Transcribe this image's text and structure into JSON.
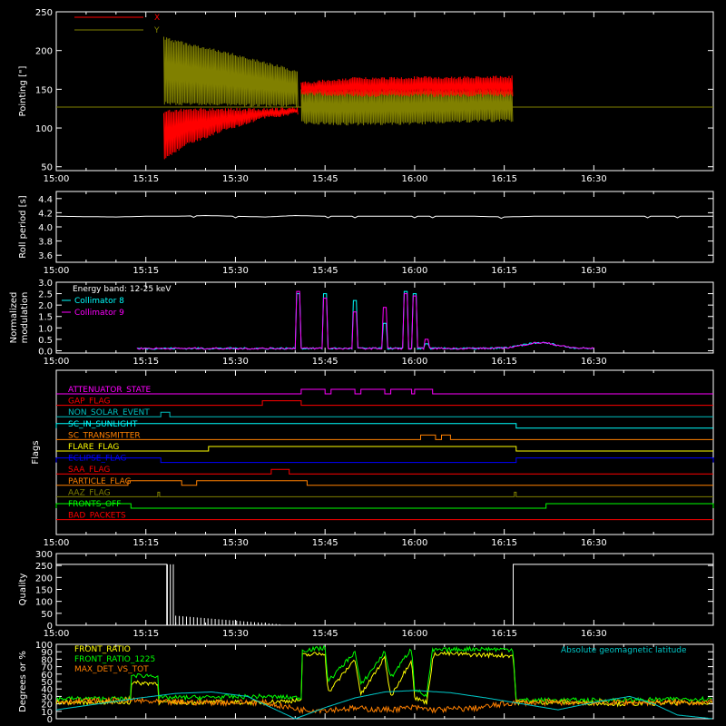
{
  "colors": {
    "background": "#000000",
    "axes": "#ffffff",
    "x_red": "#ff0000",
    "y_olive": "#808000",
    "collimator8": "#00ffff",
    "collimator9": "#ff00ff",
    "front_ratio": "#ffff00",
    "front_ratio_1225": "#00ff00",
    "max_det": "#ff8000",
    "latitude": "#00c8c8"
  },
  "time_axis": {
    "range_min": [
      0,
      110
    ],
    "tick_minutes": [
      0,
      15,
      30,
      45,
      60,
      75,
      90
    ],
    "tick_labels": [
      "15:00",
      "15:15",
      "15:30",
      "15:45",
      "16:00",
      "16:15",
      "16:30"
    ]
  },
  "chart_data": [
    {
      "type": "line",
      "ylabel": "Pointing [\"]",
      "ylim": [
        45,
        250
      ],
      "yticks": [
        50,
        100,
        150,
        200,
        250
      ],
      "legend_position": "top-left",
      "series": [
        {
          "name": "X",
          "color": "#ff0000",
          "envelope": {
            "x_min": [
              18,
              22,
              28,
              34,
              40.5,
              41,
              50,
              60,
              68,
              76.5
            ],
            "lower": [
              58,
              78,
              95,
              110,
              117,
              142,
              140,
              140,
              140,
              140
            ],
            "upper": [
              123,
              126,
              126,
              126,
              127,
              160,
              166,
              167,
              167,
              168
            ]
          }
        },
        {
          "name": "Y",
          "color": "#808000",
          "envelope": {
            "x_min": [
              18,
              22,
              28,
              34,
              40.5,
              41,
              50,
              60,
              68,
              76.5
            ],
            "lower": [
              130,
              129,
              128,
              127,
              127,
              105,
              103,
              104,
              107,
              108
            ],
            "upper": [
              218,
              210,
              200,
              188,
              175,
              150,
              150,
              150,
              150,
              150
            ]
          }
        }
      ],
      "baseline": 127
    },
    {
      "type": "line",
      "ylabel": "Roll period [s]",
      "ylim": [
        3.5,
        4.5
      ],
      "yticks": [
        3.6,
        3.8,
        4.0,
        4.2,
        4.4
      ],
      "ytick_labels": [
        "3.6",
        "3.8",
        "4.0",
        "4.2",
        "4.4"
      ],
      "series": [
        {
          "name": "",
          "color": "#ffffff",
          "level": 4.15,
          "x_min": [
            0,
            10,
            15,
            20,
            25,
            30,
            35,
            40,
            45,
            50,
            55,
            60,
            65,
            70,
            75,
            80,
            85,
            90,
            95,
            100,
            110
          ],
          "y": [
            4.15,
            4.14,
            4.15,
            4.15,
            4.16,
            4.15,
            4.14,
            4.16,
            4.15,
            4.15,
            4.15,
            4.15,
            4.15,
            4.15,
            4.14,
            4.15,
            4.15,
            4.15,
            4.15,
            4.15,
            4.15
          ]
        }
      ]
    },
    {
      "type": "line",
      "ylabel": "Normalized modulation",
      "ylim": [
        -0.1,
        3.0
      ],
      "yticks": [
        0.0,
        0.5,
        1.0,
        1.5,
        2.0,
        2.5,
        3.0
      ],
      "ytick_labels": [
        "0.0",
        "0.5",
        "1.0",
        "1.5",
        "2.0",
        "2.5",
        "3.0"
      ],
      "annotation": "Energy band: 12-25 keV",
      "legend_position": "top-left",
      "x_range_min": [
        13.5,
        90
      ],
      "base_level": 0.1,
      "spikes_min": [
        40.5,
        45,
        50,
        55,
        58.5,
        60,
        62
      ],
      "spikes_values_c8": [
        2.5,
        2.5,
        2.2,
        1.2,
        2.6,
        2.5,
        0.3
      ],
      "spikes_values_c9": [
        2.6,
        2.3,
        1.7,
        1.9,
        2.5,
        2.4,
        0.5
      ],
      "bump": {
        "center_min": 81,
        "peak": 0.25
      },
      "series": [
        {
          "name": "Collimator 8",
          "color": "#00ffff"
        },
        {
          "name": "Collimator 9",
          "color": "#ff00ff"
        }
      ]
    },
    {
      "type": "table",
      "ylabel": "Flags",
      "flags": [
        {
          "name": "ATTENUATOR_STATE",
          "color": "#ff00ff",
          "high": [
            [
              41,
              45
            ],
            [
              46,
              50
            ],
            [
              51,
              55
            ],
            [
              56,
              59.5
            ],
            [
              60,
              63
            ]
          ]
        },
        {
          "name": "GAP_FLAG",
          "color": "#ff0000",
          "high": [
            [
              34.5,
              41
            ]
          ]
        },
        {
          "name": "NON_SOLAR_EVENT",
          "color": "#00c0c0",
          "high": [
            [
              17.5,
              19
            ]
          ]
        },
        {
          "name": "SC_IN_SUNLIGHT",
          "color": "#00ffff",
          "high": [
            [
              0,
              77
            ]
          ]
        },
        {
          "name": "SC_TRANSMITTER",
          "color": "#ff8000",
          "high": [
            [
              61,
              63.5
            ],
            [
              64.5,
              66
            ]
          ]
        },
        {
          "name": "FLARE_FLAG",
          "color": "#ffff00",
          "high": [
            [
              25.5,
              77
            ]
          ]
        },
        {
          "name": "ECLIPSE_FLAG",
          "color": "#0000ff",
          "high": [
            [
              0,
              17.5
            ],
            [
              77,
              110
            ]
          ]
        },
        {
          "name": "SAA_FLAG",
          "color": "#ff0000",
          "high": [
            [
              36,
              39
            ]
          ]
        },
        {
          "name": "PARTICLE_FLAG",
          "color": "#ff8000",
          "high": [
            [
              12,
              21
            ],
            [
              23.5,
              42
            ]
          ]
        },
        {
          "name": "AAZ_FLAG",
          "color": "#808000",
          "high": [
            [
              17,
              17.3
            ],
            [
              76.7,
              77
            ]
          ]
        },
        {
          "name": "FRONTS_OFF",
          "color": "#00ff00",
          "high": [
            [
              0,
              12.5
            ],
            [
              82,
              110
            ]
          ]
        },
        {
          "name": "BAD_PACKETS",
          "color": "#ff0000",
          "high": []
        }
      ]
    },
    {
      "type": "bar",
      "ylabel": "Quality",
      "ylim": [
        0,
        300
      ],
      "yticks": [
        0,
        50,
        100,
        150,
        200,
        250,
        300
      ],
      "segments": [
        {
          "x_min": [
            0,
            18.5
          ],
          "value": 255
        },
        {
          "x_min": [
            76.5,
            110
          ],
          "value": 255
        }
      ],
      "spikes_min": [
        18.6,
        19.1,
        19.6
      ],
      "spikes_values": [
        255,
        255,
        255
      ],
      "decay": {
        "start_min": 20,
        "end_min": 38,
        "start_value": 40,
        "end_value": 3
      }
    },
    {
      "type": "line",
      "ylabel": "Degrees or %",
      "ylim": [
        0,
        100
      ],
      "yticks": [
        0,
        10,
        20,
        30,
        40,
        50,
        60,
        70,
        80,
        90,
        100
      ],
      "legend_position": "top-left",
      "right_annotation": "Absolute geomagnetic latitude",
      "series": [
        {
          "name": "FRONT_RATIO",
          "color": "#ffff00",
          "x_min": [
            0,
            12.5,
            12.6,
            17,
            17.1,
            34.5,
            41,
            41.1,
            45,
            45.5,
            50,
            51,
            55,
            56,
            59.5,
            60,
            62,
            63,
            63.5,
            70,
            76.5,
            77,
            85,
            95,
            110
          ],
          "y": [
            22,
            22,
            48,
            48,
            22,
            22,
            25,
            85,
            88,
            35,
            80,
            32,
            82,
            30,
            80,
            28,
            22,
            78,
            88,
            86,
            85,
            22,
            22,
            20,
            22
          ]
        },
        {
          "name": "FRONT_RATIO_1225",
          "color": "#00ff00",
          "x_min": [
            0,
            12.5,
            12.6,
            17,
            17.1,
            34.5,
            41,
            41.1,
            45,
            45.5,
            50,
            51,
            55,
            56,
            59.5,
            60,
            62,
            63,
            63.5,
            70,
            76.5,
            77,
            85,
            95,
            110
          ],
          "y": [
            27,
            27,
            58,
            58,
            28,
            30,
            28,
            92,
            95,
            50,
            90,
            45,
            90,
            55,
            95,
            40,
            30,
            92,
            92,
            94,
            93,
            25,
            25,
            25,
            27
          ]
        },
        {
          "name": "MAX_DET_VS_TOT",
          "color": "#ff8000",
          "x_min": [
            0,
            12.5,
            17,
            25,
            34.5,
            41,
            45,
            50,
            55,
            60,
            63,
            70,
            77,
            85,
            95,
            110
          ],
          "y": [
            23,
            25,
            22,
            22,
            22,
            12,
            12,
            14,
            12,
            15,
            12,
            14,
            22,
            22,
            22,
            22
          ]
        },
        {
          "name": "",
          "color": "#00c8c8",
          "label": "Absolute geomagnetic latitude",
          "x_min": [
            0,
            7,
            14,
            20,
            26,
            32,
            36,
            40,
            45,
            50,
            55,
            60,
            66,
            72,
            78,
            84,
            90,
            96,
            100,
            104,
            110
          ],
          "y": [
            12,
            20,
            28,
            34,
            36,
            30,
            15,
            0,
            15,
            28,
            36,
            38,
            35,
            28,
            20,
            12,
            22,
            30,
            20,
            5,
            0
          ]
        }
      ]
    }
  ]
}
